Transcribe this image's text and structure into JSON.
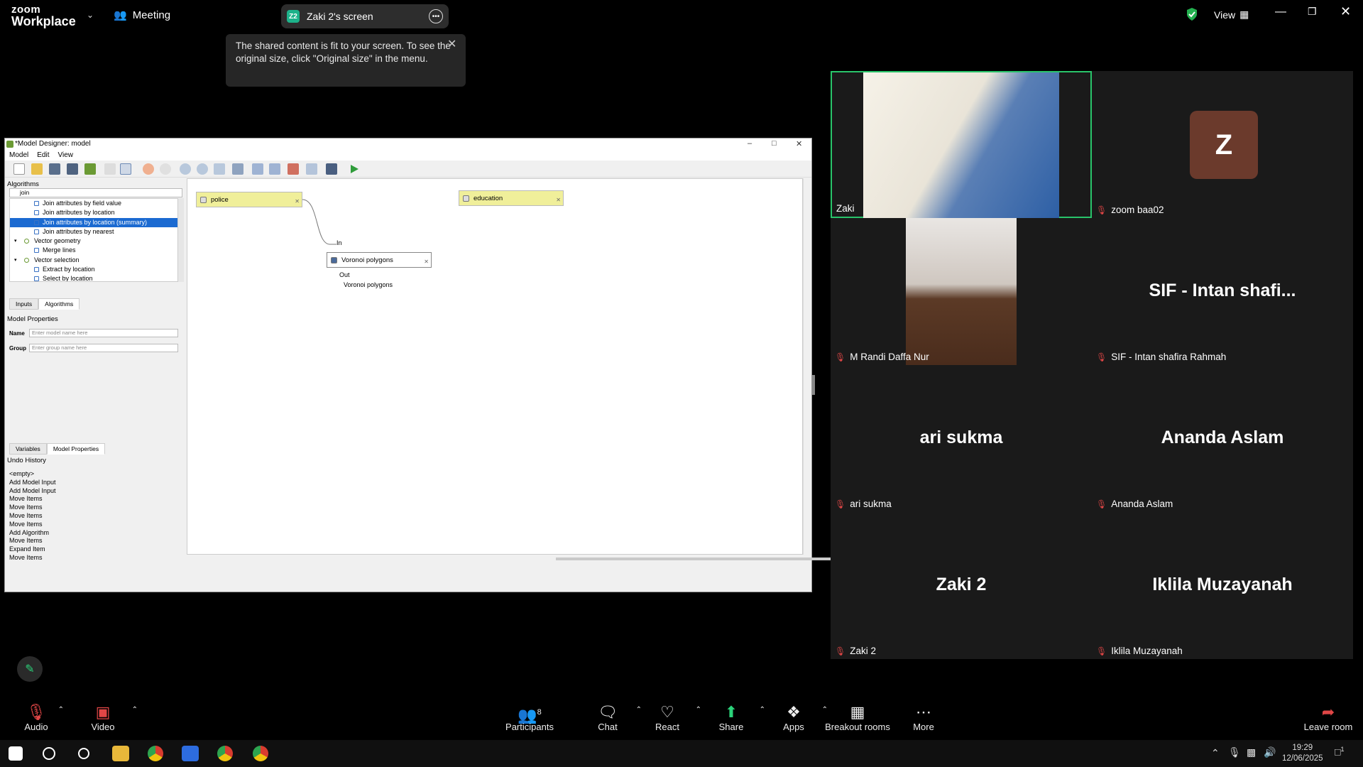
{
  "zoom": {
    "logo_line1": "zoom",
    "logo_line2": "Workplace",
    "meeting_label": "Meeting",
    "screen_pill": {
      "badge": "Z2",
      "label": "Zaki 2's screen"
    },
    "view_label": "View",
    "tooltip": "The shared content is fit to your screen. To see the original size, click \"Original size\" in the menu."
  },
  "qgis": {
    "title": "*Model Designer: model",
    "menu": [
      "Model",
      "Edit",
      "View"
    ],
    "algorithms_title": "Algorithms",
    "search_value": "join",
    "alg_items": [
      {
        "label": "Join attributes by field value",
        "group": false,
        "selected": false
      },
      {
        "label": "Join attributes by location",
        "group": false,
        "selected": false
      },
      {
        "label": "Join attributes by location (summary)",
        "group": false,
        "selected": true
      },
      {
        "label": "Join attributes by nearest",
        "group": false,
        "selected": false
      },
      {
        "label": "Vector geometry",
        "group": true,
        "selected": false
      },
      {
        "label": "Merge lines",
        "group": false,
        "selected": false
      },
      {
        "label": "Vector selection",
        "group": true,
        "selected": false
      },
      {
        "label": "Extract by location",
        "group": false,
        "selected": false
      },
      {
        "label": "Select by location",
        "group": false,
        "selected": false
      }
    ],
    "tabs_top": [
      "Inputs",
      "Algorithms"
    ],
    "model_properties_title": "Model Properties",
    "name_label": "Name",
    "name_placeholder": "Enter model name here",
    "group_label": "Group",
    "group_placeholder": "Enter group name here",
    "tabs_bottom": [
      "Variables",
      "Model Properties"
    ],
    "undo_title": "Undo History",
    "undo_items": [
      "<empty>",
      "Add Model Input",
      "Add Model Input",
      "Move Items",
      "Move Items",
      "Move Items",
      "Move Items",
      "Add Algorithm",
      "Move Items",
      "Expand Item",
      "Move Items"
    ],
    "canvas": {
      "input_police": "police",
      "input_education": "education",
      "port_in": "In",
      "algorithm": "Voronoi polygons",
      "port_out": "Out",
      "output_label": "Voronoi polygons"
    }
  },
  "participants": [
    {
      "name": "Zaki",
      "big": "",
      "muted": false,
      "video": "photo1",
      "active": true
    },
    {
      "name": "zoom baa02",
      "big": "Z",
      "muted": true,
      "video": "avatar",
      "active": false
    },
    {
      "name": "M Randi Daffa Nur",
      "big": "",
      "muted": true,
      "video": "photo2",
      "active": false
    },
    {
      "name": "SIF - Intan shafira Rahmah",
      "big": "SIF - Intan shafi...",
      "muted": true,
      "video": "none",
      "active": false
    },
    {
      "name": "ari sukma",
      "big": "ari sukma",
      "muted": true,
      "video": "none",
      "active": false
    },
    {
      "name": "Ananda Aslam",
      "big": "Ananda Aslam",
      "muted": true,
      "video": "none",
      "active": false
    },
    {
      "name": "Zaki 2",
      "big": "Zaki 2",
      "muted": true,
      "video": "none",
      "active": false
    },
    {
      "name": "Iklila Muzayanah",
      "big": "Iklila Muzayanah",
      "muted": true,
      "video": "none",
      "active": false
    }
  ],
  "bottom_bar": {
    "audio": "Audio",
    "video": "Video",
    "participants": "Participants",
    "participants_count": "8",
    "chat": "Chat",
    "react": "React",
    "share": "Share",
    "apps": "Apps",
    "breakout": "Breakout rooms",
    "more": "More",
    "leave": "Leave room"
  },
  "taskbar": {
    "time": "19:29",
    "date": "12/06/2025",
    "notifications": "1"
  },
  "colors": {
    "active_speaker": "#29c46a",
    "share_green": "#2bd37a",
    "muted_red": "#e04646",
    "selection_blue": "#1b6ad1"
  }
}
